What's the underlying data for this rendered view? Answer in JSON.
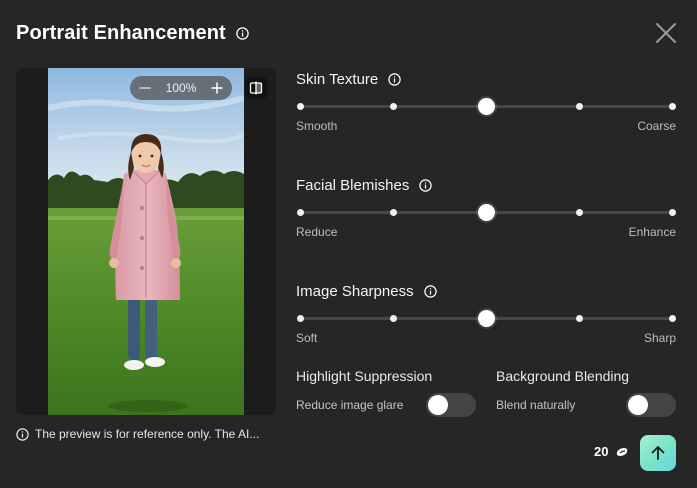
{
  "dialog": {
    "title": "Portrait Enhancement",
    "info_icon": "info-icon",
    "close_icon": "close-icon"
  },
  "preview": {
    "zoom_level": "100%",
    "zoom_out_icon": "minus-icon",
    "zoom_in_icon": "plus-icon",
    "compare_icon": "compare-split-icon",
    "disclaimer": "The preview is for reference only. The AI..."
  },
  "sliders": [
    {
      "title": "Skin Texture",
      "min_label": "Smooth",
      "max_label": "Coarse",
      "steps": 5,
      "value_index": 2
    },
    {
      "title": "Facial Blemishes",
      "min_label": "Reduce",
      "max_label": "Enhance",
      "steps": 5,
      "value_index": 2
    },
    {
      "title": "Image Sharpness",
      "min_label": "Soft",
      "max_label": "Sharp",
      "steps": 5,
      "value_index": 2
    }
  ],
  "toggles": [
    {
      "title": "Highlight Suppression",
      "description": "Reduce image glare",
      "on": false
    },
    {
      "title": "Background Blending",
      "description": "Blend naturally",
      "on": false
    }
  ],
  "footer": {
    "credits": "20",
    "credit_icon": "coin-icon",
    "submit_icon": "arrow-up-icon"
  },
  "colors": {
    "background": "#262626",
    "accent_gradient_start": "#a6f0d2",
    "accent_gradient_end": "#6ad6e0",
    "track": "#474747"
  }
}
